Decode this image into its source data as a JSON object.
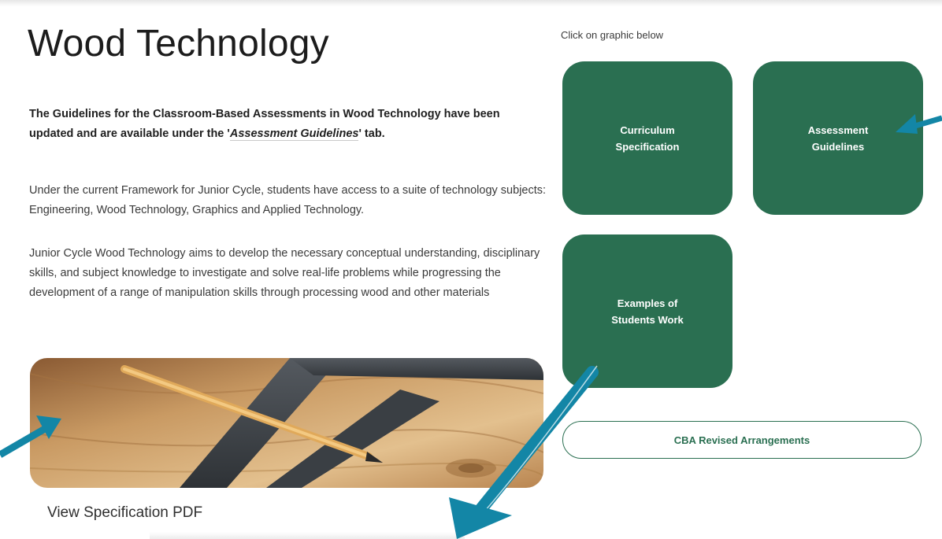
{
  "page": {
    "title": "Wood Technology",
    "intro_prefix": "The Guidelines for the Classroom-Based Assessments in Wood Technology have been updated and are available under the '",
    "intro_tab_name": "Assessment Guidelines",
    "intro_suffix": "' tab.",
    "paragraph1": "Under the current Framework for Junior Cycle, students have access to a suite of technology subjects: Engineering, Wood Technology, Graphics and Applied Technology.",
    "paragraph2": "Junior Cycle Wood Technology aims to develop the necessary conceptual understanding, disciplinary skills, and subject knowledge to investigate and solve real-life problems while progressing the development of a range of manipulation skills through processing wood and other materials",
    "view_spec_label": "View Specification PDF"
  },
  "right_panel": {
    "hint": "Click on graphic below",
    "tiles": [
      {
        "label": "Curriculum\nSpecification"
      },
      {
        "label": "Assessment\nGuidelines"
      },
      {
        "label": "Examples of\nStudents Work"
      }
    ],
    "cba_button_label": "CBA Revised Arrangements"
  },
  "colors": {
    "tile_green": "#2a6f51",
    "arrow_blue": "#1386a6",
    "heading_text": "#1c1c1c",
    "body_text": "#3a3a3a"
  },
  "icons": {
    "callout_arrows": "arrow-icon",
    "hero_image": "woodworking-tools-image"
  }
}
